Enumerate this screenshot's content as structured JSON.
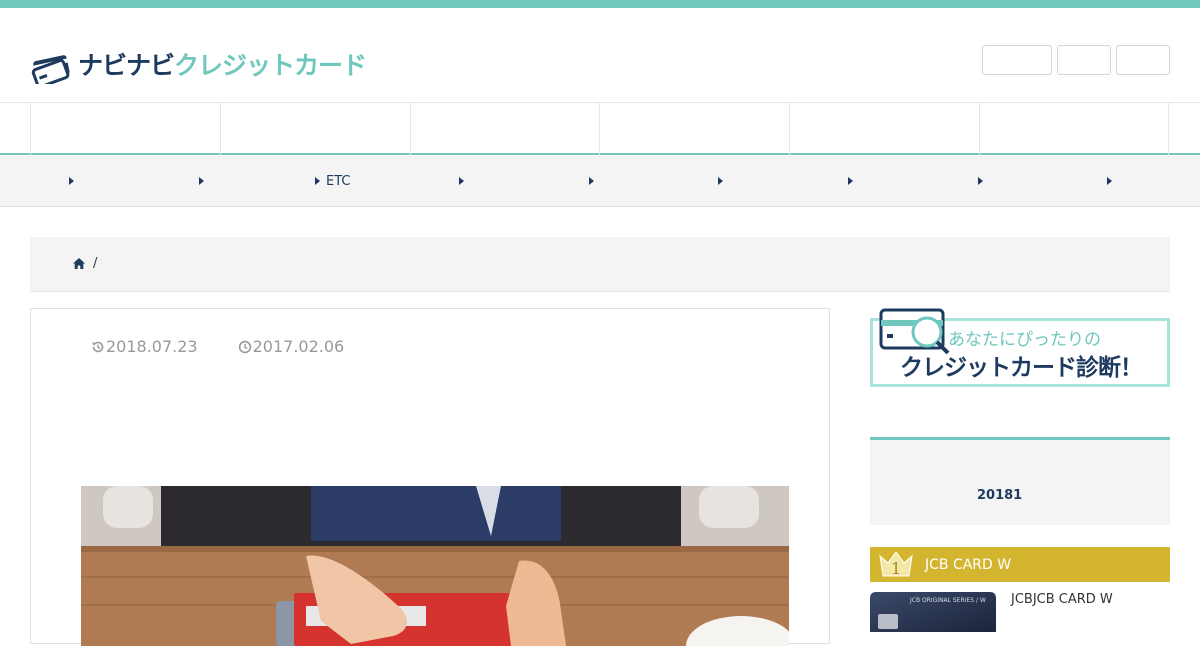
{
  "header": {
    "logo_part1": "ナビナビ",
    "logo_part2": "クレジットカード"
  },
  "subnav": {
    "items": [
      "",
      "",
      "ETC",
      "",
      "",
      "",
      "",
      "",
      ""
    ]
  },
  "article": {
    "updated_date": "2018.07.23",
    "published_date": "2017.02.06"
  },
  "breadcrumb": {
    "separator": "/"
  },
  "sidebar": {
    "banner_line1": "あなたにぴったりの",
    "banner_line2": "クレジットカード診断！",
    "widget_text": "20181",
    "ranking": {
      "rank": "1",
      "title": "JCB CARD W",
      "card_name": "JCBJCB CARD W",
      "card_print": "JCB ORIGINAL SERIES / W"
    }
  },
  "colors": {
    "accent": "#6fc7bd",
    "navy": "#1e3a5f",
    "gold": "#d3b52f"
  }
}
